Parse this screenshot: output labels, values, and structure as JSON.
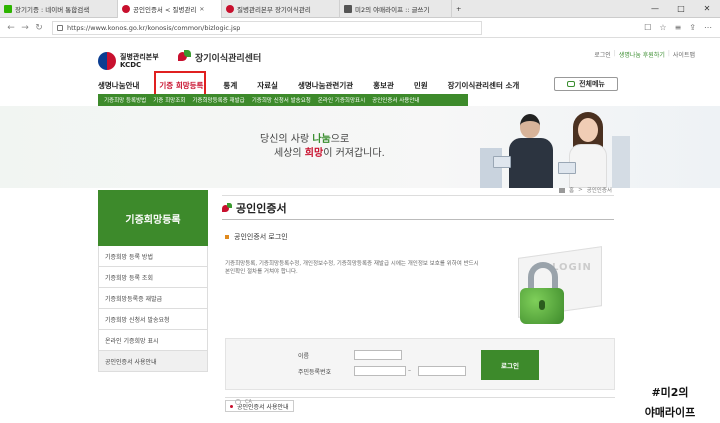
{
  "browser": {
    "tabs": [
      {
        "label": "장기기증 : 네이버 통합검색",
        "icon_color": "#2db400",
        "active": false
      },
      {
        "label": "공인인증서 < 질병관리",
        "icon_color": "#c8102e",
        "active": true
      },
      {
        "label": "질병관리본부 장기이식관리",
        "icon_color": "#c8102e",
        "active": false
      },
      {
        "label": "미2의 야매라이프 :: 글쓰기",
        "icon_color": "#555555",
        "active": false
      }
    ],
    "url": "https://www.konos.go.kr/konosis/common/bizlogic.jsp",
    "window_controls": [
      "—",
      "□",
      "✕"
    ]
  },
  "header": {
    "kdca_line1": "질병관리본부",
    "kdca_line2": "KCDC",
    "knos_name": "장기이식관리센터",
    "toplinks": [
      "로그인",
      "생명나눔 후원하기",
      "사이트맵"
    ]
  },
  "gnb": {
    "items": [
      "생명나눔안내",
      "기증 희망등록",
      "통계",
      "자료실",
      "생명나눔관련기관",
      "홍보관",
      "민원",
      "장기이식관리센터 소개"
    ],
    "active_index": 1,
    "all_menu": "전체메뉴"
  },
  "subnav": {
    "items": [
      "기증희망 등록방법",
      "기증 희망조회",
      "기증희망등록증 재발급",
      "기증희망 신청서 발송요청",
      "온라인 기증희망표시",
      "공인인증서 사용안내"
    ]
  },
  "banner": {
    "line1_pre": "당신의 사랑 ",
    "line1_hl": "나눔",
    "line1_post": "으로",
    "line2_pre": "세상의 ",
    "line2_hl": "희망",
    "line2_post": "이 커져갑니다."
  },
  "sidebar": {
    "title": "기증희망등록",
    "items": [
      "기증희망 등록 방법",
      "기증희망 등록 조회",
      "기증희망등록증 재발급",
      "기증희망 신청서 발송요청",
      "온라인 기증희망 표시",
      "공인인증서 사용안내"
    ],
    "current_index": 5
  },
  "content": {
    "location": [
      "홈",
      "공인인증서"
    ],
    "title": "공인인증서",
    "section": "공인인증서 로그인",
    "desc": "기증희망등록, 기증희망등록수정, 개인정보수정, 기증희망등록증 재발급 시에는 개인정보 보호를 위하여 반드시 본인확인 절차를 거쳐야 합니다.",
    "lock_word": "LOGIN",
    "form": {
      "name_label": "이름",
      "rrn_label": "주민등록번호",
      "dash": "–",
      "login_button": "로그인"
    },
    "guide_button": "공인인증서 사용안내",
    "bottom_label": "CA"
  },
  "watermark": {
    "line1": "#미2의",
    "line2": "야매라이프"
  }
}
